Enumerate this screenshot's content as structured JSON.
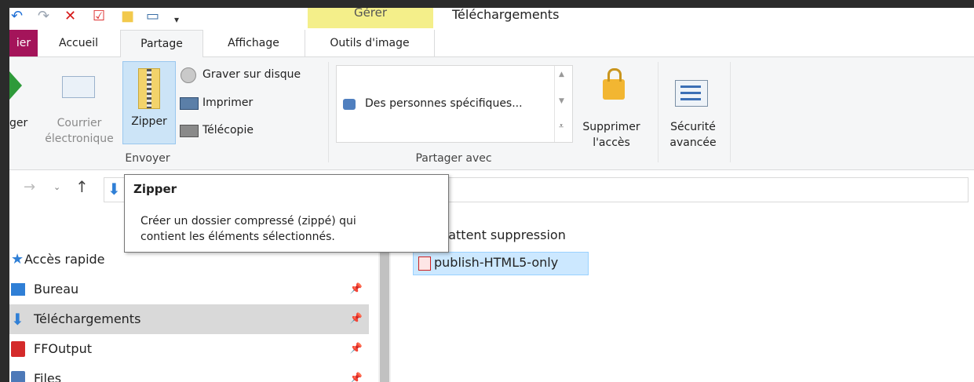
{
  "title_bar": {
    "gerer_label": "Gérer",
    "window_title": "Téléchargements"
  },
  "tabs": [
    {
      "label": "ier",
      "selected": false
    },
    {
      "label": "Accueil",
      "selected": false
    },
    {
      "label": "Partage",
      "selected": true
    },
    {
      "label": "Affichage",
      "selected": false
    },
    {
      "label": "Outils d'image",
      "selected": false
    }
  ],
  "ribbon": {
    "share_label": "ger",
    "email_label_1": "Courrier",
    "email_label_2": "électronique",
    "zip_label": "Zipper",
    "burn_label": "Graver sur disque",
    "print_label": "Imprimer",
    "fax_label": "Télécopie",
    "send_group_label": "Envoyer",
    "specific_people_label": "Des personnes spécifiques...",
    "share_with_group_label": "Partager avec",
    "remove_access_1": "Supprimer",
    "remove_access_2": "l'accès",
    "advanced_security_1": "Sécurité",
    "advanced_security_2": "avancée"
  },
  "tooltip": {
    "title": "Zipper",
    "description": "Créer un dossier compressé (zippé) qui\ncontient les éléments sélectionnés."
  },
  "nav": {
    "items": [
      {
        "label": "Accès rapide",
        "pinned": false,
        "selected": false
      },
      {
        "label": "Bureau",
        "pinned": true,
        "selected": false
      },
      {
        "label": "Téléchargements",
        "pinned": true,
        "selected": true
      },
      {
        "label": "FFOutput",
        "pinned": true,
        "selected": false
      },
      {
        "label": "Files",
        "pinned": true,
        "selected": false
      }
    ]
  },
  "content": {
    "group_header": "n attent suppression",
    "file_name": "publish-HTML5-only"
  },
  "colors": {
    "file_tab": "#a4145a",
    "gerer_tab": "#f4ef8a",
    "selection": "#cce8ff",
    "nav_selected": "#d9d9d9"
  }
}
